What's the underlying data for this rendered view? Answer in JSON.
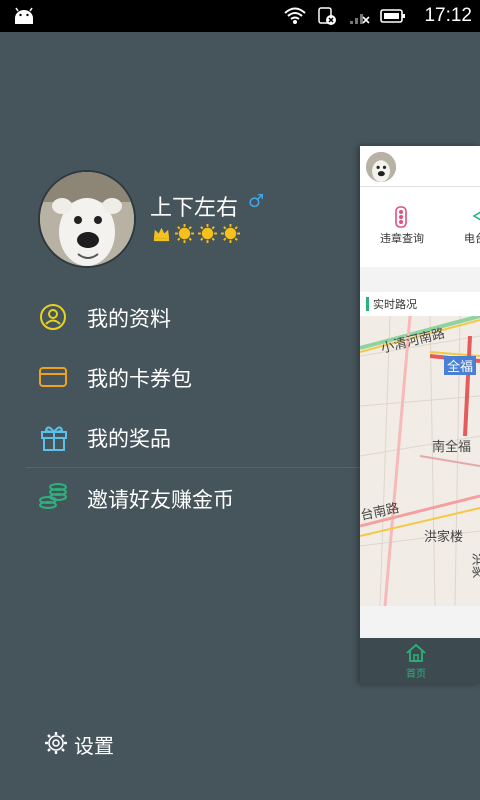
{
  "status_bar": {
    "time": "17:12",
    "icons": [
      "android-icon",
      "wifi-icon",
      "sim-icon",
      "signal-icon",
      "battery-icon"
    ]
  },
  "profile": {
    "username": "上下左右",
    "gender_symbol": "♂",
    "level_icons": [
      "crown-icon",
      "sun-icon",
      "sun-icon",
      "sun-icon"
    ]
  },
  "menu": {
    "items": [
      {
        "label": "我的资料",
        "icon": "profile-icon"
      },
      {
        "label": "我的卡券包",
        "icon": "card-icon"
      },
      {
        "label": "我的奖品",
        "icon": "gift-icon"
      },
      {
        "label": "邀请好友赚金币",
        "icon": "coins-icon"
      }
    ]
  },
  "settings": {
    "label": "设置",
    "icon": "gear-icon"
  },
  "main_peek": {
    "quick_actions": [
      {
        "label": "违章查询",
        "icon": "traffic-light-icon"
      },
      {
        "label": "电台",
        "icon": "radio-icon"
      }
    ],
    "traffic_title": "实时路况",
    "map_labels": [
      "小清河南路",
      "全福",
      "南全福",
      "台南路",
      "洪家楼",
      "洪家"
    ],
    "tab_home_label": "首页"
  },
  "colors": {
    "drawer_bg": "#46545c",
    "accent_green": "#2bb37c",
    "gender_blue": "#43a8e8",
    "gold": "#f4c21b"
  }
}
